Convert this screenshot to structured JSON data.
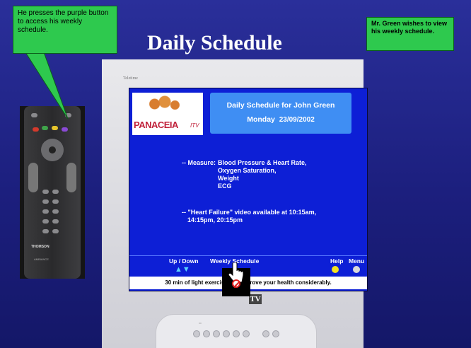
{
  "slide": {
    "title": "Daily Schedule",
    "callout_left": "He presses the purple button to access his weekly schedule.",
    "callout_right": "Mr. Green wishes to view his weekly schedule."
  },
  "tv": {
    "brand": "Teletime",
    "mark": "TV",
    "logo_text": "PANACEIA",
    "logo_sub": "ITV",
    "header_title": "Daily Schedule for John Green",
    "day": "Monday",
    "date": "23/09/2002",
    "measure_label": "-- Measure:",
    "measures": [
      "Blood Pressure & Heart Rate,",
      "Oxygen Saturation,",
      "Weight",
      "ECG"
    ],
    "video_line1": "-- \"Heart Failure\" video available at 10:15am,",
    "video_line2": "14:15pm, 20:15pm",
    "nav": {
      "up_down": "Up / Down",
      "weekly": "Weekly Schedule",
      "help": "Help",
      "menu": "Menu"
    },
    "ticker": "30 min of light exercise will improve your health considerably."
  },
  "remote": {
    "brand": "THOMSON",
    "model": "AMBIANCE"
  },
  "colors": {
    "background": "#1f2388",
    "screen": "#0d1fd6",
    "header_box": "#3f8ef3",
    "callout": "#2ec94e",
    "purple_button": "#8a4ad6"
  }
}
